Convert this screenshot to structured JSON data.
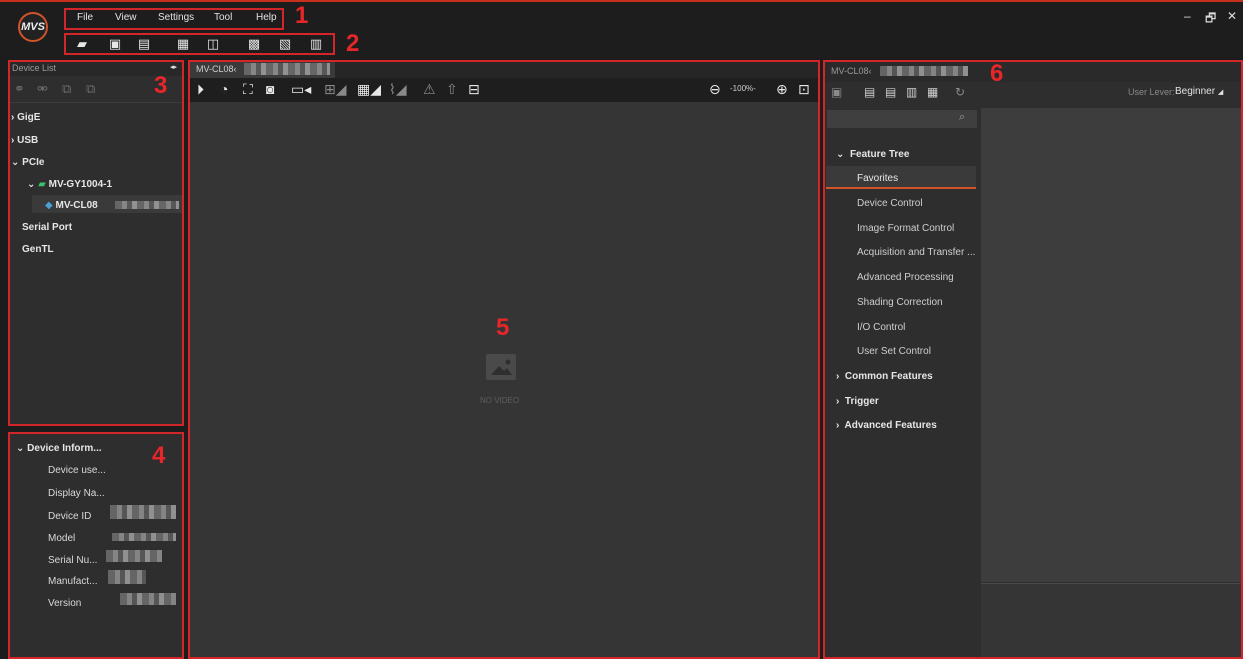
{
  "menu": {
    "items": [
      "File",
      "View",
      "Settings",
      "Tool",
      "Help"
    ]
  },
  "labels": {
    "one": "1",
    "two": "2",
    "three": "3",
    "four": "4",
    "five": "5",
    "six": "6"
  },
  "logo_text": "MVS",
  "window_controls": {
    "minimize": "–",
    "restore": "🗗",
    "close": "✕"
  },
  "device_list": {
    "title": "Device List",
    "collapse": "◂▸",
    "groups": [
      {
        "label": "GigE",
        "marker": "›"
      },
      {
        "label": "USB",
        "marker": "›"
      },
      {
        "label": "PCIe",
        "marker": "⌄"
      },
      {
        "label": "MV-GY1004-1",
        "marker": "⌄"
      },
      {
        "label": "MV-CL08",
        "marker": ""
      },
      {
        "label": "Serial Port",
        "marker": ""
      },
      {
        "label": "GenTL",
        "marker": ""
      }
    ]
  },
  "device_info": {
    "title": "Device Inform...",
    "rows": [
      "Device use...",
      "Display Na...",
      "Device ID",
      "Model",
      "Serial Nu...",
      "Manufact...",
      "Version"
    ]
  },
  "view": {
    "tab_title": "MV-CL08‹",
    "zoom": "-100%-",
    "no_video": "NO VIDEO"
  },
  "features": {
    "tab_title": "MV-CL08‹",
    "user_level_label": "User Lever:",
    "user_level_value": "Beginner",
    "tree_title": "Feature Tree",
    "items": [
      "Favorites",
      "Device Control",
      "Image Format Control",
      "Acquisition and Transfer ...",
      "Advanced Processing",
      "Shading Correction",
      "I/O Control",
      "User Set Control"
    ],
    "groups": [
      "Common Features",
      "Trigger",
      "Advanced Features"
    ],
    "search_icon": "search-icon"
  },
  "colors": {
    "accent": "#d3262a",
    "panel": "#2e2e2e",
    "selected": "#3a3a3a",
    "orange": "#d0532a"
  }
}
